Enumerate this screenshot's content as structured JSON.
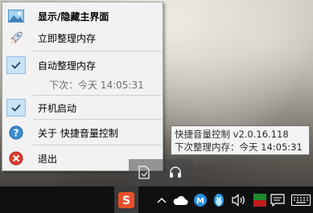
{
  "menu": {
    "items": [
      {
        "label": "显示/隐藏主界面",
        "icon": "window-image-icon"
      },
      {
        "label": "立即整理内存",
        "icon": "rocket-icon"
      },
      {
        "label": "自动整理内存",
        "icon": "check-icon",
        "checked": true
      },
      {
        "label": "下次：今天 14:05:31",
        "disabled": true
      },
      {
        "label": "开机启动",
        "icon": "check-icon",
        "checked": true
      },
      {
        "label": "关于 快捷音量控制",
        "icon": "help-icon"
      },
      {
        "label": "退出",
        "icon": "exit-icon"
      }
    ]
  },
  "tooltip": {
    "line1": "快捷音量控制 v2.0.16.118",
    "line2": "下次整理内存：今天 14:05:31"
  },
  "overflow_icons": [
    "document-icon",
    "headphones-icon"
  ],
  "taskbar": {
    "icons": [
      "sogou-ime-icon",
      "show-hidden-icons-chevron",
      "onedrive-cloud-icon",
      "maxthon-icon",
      "qq-penguin-icon",
      "volume-icon",
      "app-indicator-icon",
      "notification-icon",
      "keyboard-icon"
    ],
    "ime_label": "S"
  },
  "colors": {
    "menu_bg": "#f2f2f2",
    "check_bg": "#c9e2f6",
    "taskbar_bg": "#101010",
    "tooltip_bg": "#f3f3f3"
  }
}
